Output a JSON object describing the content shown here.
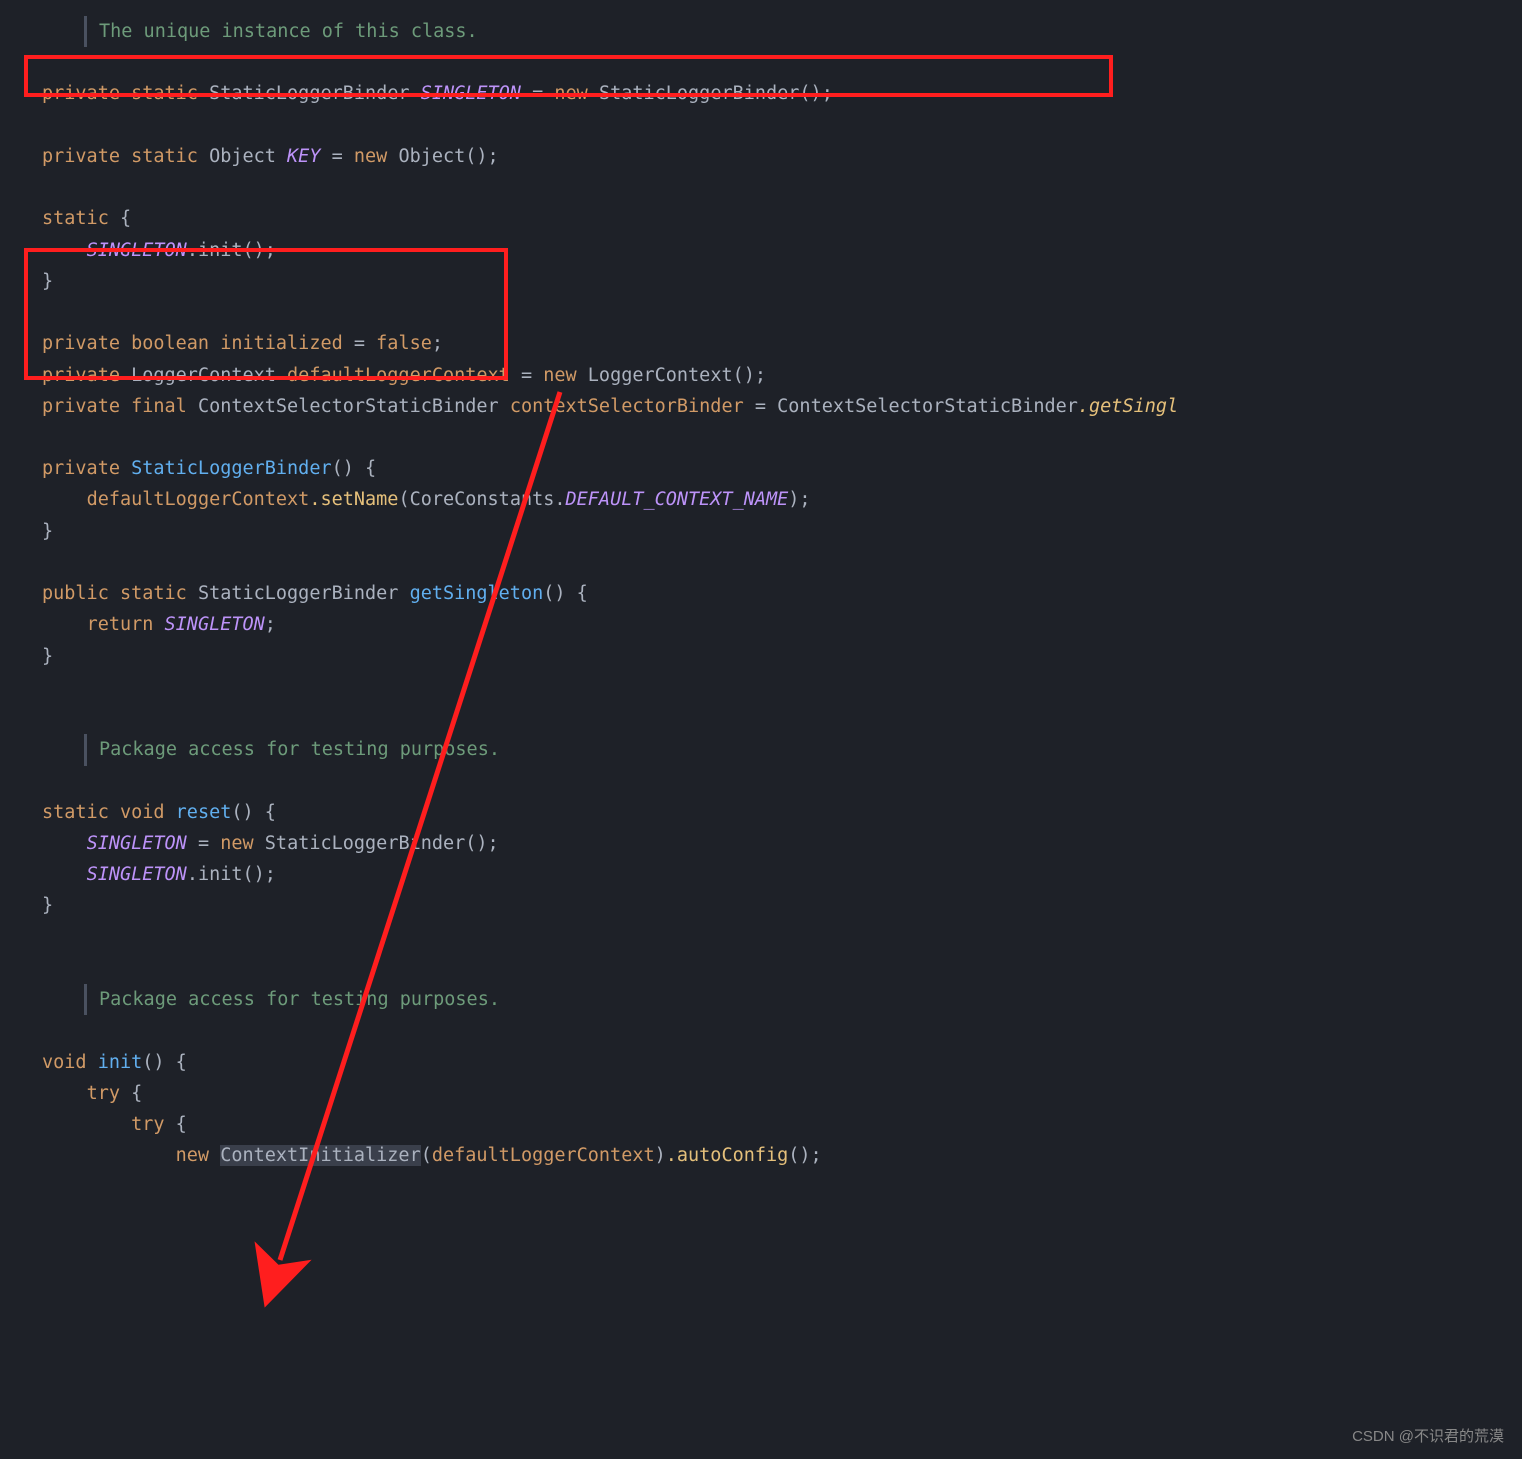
{
  "doc1": "The unique instance of this class.",
  "l1": {
    "private": "private",
    "static": "static",
    "type": "StaticLoggerBinder",
    "field": "SINGLETON",
    "eq": " = ",
    "new": "new",
    "ctor": "StaticLoggerBinder",
    "end": "();"
  },
  "l2": {
    "private": "private",
    "static": "static",
    "type": "Object",
    "field": "KEY",
    "eq": " = ",
    "new": "new",
    "ctor": "Object",
    "end": "();"
  },
  "sb": {
    "static": "static",
    "ob": " {",
    "field": "SINGLETON",
    "method": ".init",
    "end": "();",
    "cb": "}"
  },
  "l3": {
    "private": "private",
    "type": "boolean",
    "field": "initialized",
    "eq": " = ",
    "val": "false",
    "end": ";"
  },
  "l4": {
    "private": "private",
    "type": "LoggerContext",
    "field": "defaultLoggerContext",
    "eq": " = ",
    "new": "new",
    "ctor": "LoggerContext",
    "end": "();"
  },
  "l5": {
    "private": "private",
    "final": "final",
    "type": "ContextSelectorStaticBinder",
    "field": "contextSelectorBinder",
    "eq": " = ",
    "cls": "ContextSelectorStaticBinder",
    "method": ".getSingl"
  },
  "ctor": {
    "private": "private",
    "name": "StaticLoggerBinder",
    "sig": "() {",
    "field": "defaultLoggerContext",
    "method": ".setName",
    "op": "(",
    "cls": "CoreConstants",
    "dot": ".",
    "const": "DEFAULT_CONTEXT_NAME",
    "end": ");",
    "cb": "}"
  },
  "gs": {
    "public": "public",
    "static": "static",
    "ret": "StaticLoggerBinder",
    "name": "getSingleton",
    "sig": "() {",
    "return": "return",
    "field": "SINGLETON",
    "end": ";",
    "cb": "}"
  },
  "doc2": "Package access for testing purposes.",
  "reset": {
    "static": "static",
    "void": "void",
    "name": "reset",
    "sig": "() {",
    "f1": "SINGLETON",
    "eq": " = ",
    "new": "new",
    "ctor": "StaticLoggerBinder",
    "e1": "();",
    "f2": "SINGLETON",
    "m2": ".init",
    "e2": "();",
    "cb": "}"
  },
  "doc3": "Package access for testing purposes.",
  "init": {
    "void": "void",
    "name": "init",
    "sig": "() {",
    "try": "try",
    "ob": " {",
    "try2": "try",
    "ob2": " {",
    "new": "new",
    "cls": "ContextInitializer",
    "op": "(",
    "arg": "defaultLoggerContext",
    "cp": ")",
    "m": ".autoConfig",
    "end": "();"
  },
  "watermark": "CSDN @不识君的荒漠"
}
